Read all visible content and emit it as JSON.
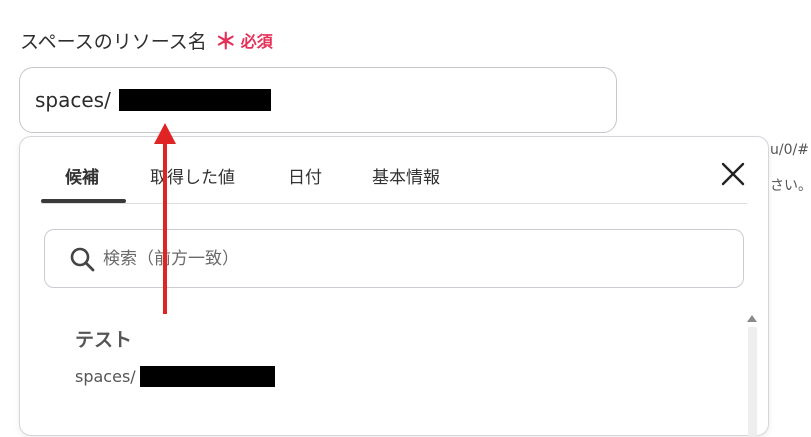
{
  "field": {
    "label": "スペースのリソース名",
    "required_mark": "＊",
    "required_text": "必須",
    "value_prefix": "spaces/"
  },
  "background_hints": {
    "line1": "u/0/#",
    "line2": "さい。例"
  },
  "popup": {
    "tabs": [
      {
        "label": "候補",
        "active": true
      },
      {
        "label": "取得した値",
        "active": false
      },
      {
        "label": "日付",
        "active": false
      },
      {
        "label": "基本情報",
        "active": false
      }
    ],
    "close_icon": "close-icon",
    "search": {
      "placeholder": "検索（前方一致）",
      "icon": "search-icon"
    },
    "suggestions": [
      {
        "title": "テスト",
        "subtitle": "spaces/"
      }
    ]
  },
  "colors": {
    "required": "#e5315a",
    "arrow": "#e02424",
    "active_tab_underline": "#3a3a3a"
  }
}
